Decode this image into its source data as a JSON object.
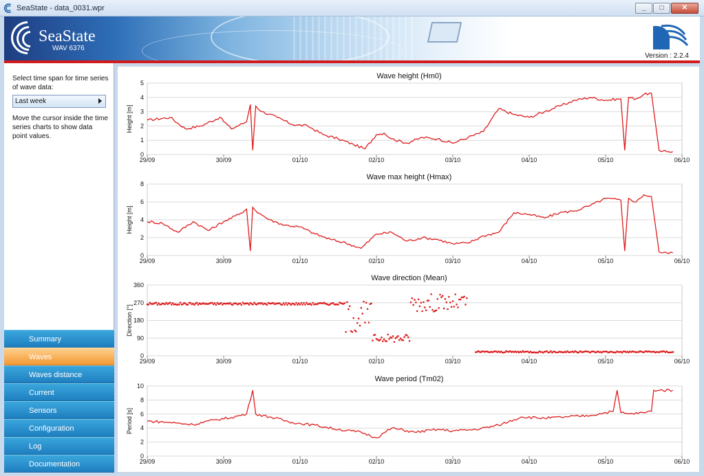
{
  "window": {
    "title": "SeaState - data_0031.wpr",
    "min": "_",
    "max": "□",
    "close": "✕"
  },
  "banner": {
    "logo_text": "SeaState",
    "logo_sub": "WAV 6376",
    "version": "Version : 2.2.4"
  },
  "left": {
    "instruction": "Select time span for time series of wave data:",
    "timespan": "Last week",
    "hint": "Move the cursor inside the time series charts to show data point values."
  },
  "nav": [
    "Summary",
    "Waves",
    "Waves distance",
    "Current",
    "Sensors",
    "Configuration",
    "Log",
    "Documentation"
  ],
  "nav_active": "Waves",
  "colors": {
    "series": "#dd1c1c",
    "accent": "#d21b1b",
    "nav": "#2a8fcd",
    "nav_active": "#f7a84a"
  },
  "chart_data": [
    {
      "type": "line",
      "title": "Wave height (Hm0)",
      "ylabel": "Height [m]",
      "ylim": [
        0,
        5
      ],
      "yticks": [
        0,
        1,
        2,
        3,
        4,
        5
      ],
      "xticks": [
        "29/09",
        "30/09",
        "01/10",
        "02/10",
        "03/10",
        "04/10",
        "05/10",
        "06/10"
      ],
      "x_days": [
        0,
        0.3,
        0.5,
        0.7,
        0.95,
        1.1,
        1.3,
        1.35,
        1.38,
        1.42,
        1.5,
        1.7,
        1.9,
        2.1,
        2.3,
        2.5,
        2.7,
        2.85,
        3.0,
        3.1,
        3.2,
        3.4,
        3.6,
        3.8,
        4.0,
        4.2,
        4.4,
        4.6,
        4.8,
        5.0,
        5.2,
        5.4,
        5.6,
        5.8,
        6.0,
        6.2,
        6.25,
        6.3,
        6.4,
        6.5,
        6.6,
        6.7,
        6.73,
        6.8,
        6.88
      ],
      "values": [
        2.4,
        2.6,
        1.8,
        2.0,
        2.6,
        1.8,
        2.3,
        3.5,
        0.3,
        3.4,
        3.0,
        2.6,
        2.1,
        2.0,
        1.4,
        1.1,
        0.7,
        0.4,
        1.4,
        1.5,
        1.1,
        0.8,
        1.2,
        1.1,
        0.8,
        1.2,
        1.6,
        3.2,
        2.8,
        2.6,
        3.0,
        3.4,
        3.8,
        4.0,
        3.8,
        3.9,
        0.3,
        4.0,
        3.9,
        4.2,
        4.3,
        0.3,
        0.2,
        0.2,
        0.2
      ]
    },
    {
      "type": "line",
      "title": "Wave max height (Hmax)",
      "ylabel": "Height [m]",
      "ylim": [
        0,
        8
      ],
      "yticks": [
        0,
        2,
        4,
        6,
        8
      ],
      "xticks": [
        "29/09",
        "30/09",
        "01/10",
        "02/10",
        "03/10",
        "04/10",
        "05/10",
        "06/10"
      ],
      "x_days": [
        0,
        0.2,
        0.4,
        0.6,
        0.8,
        1.0,
        1.2,
        1.3,
        1.35,
        1.38,
        1.42,
        1.6,
        1.8,
        2.0,
        2.2,
        2.4,
        2.6,
        2.8,
        3.0,
        3.2,
        3.4,
        3.6,
        3.8,
        4.0,
        4.2,
        4.4,
        4.6,
        4.8,
        5.0,
        5.2,
        5.4,
        5.6,
        5.8,
        6.0,
        6.2,
        6.25,
        6.3,
        6.4,
        6.5,
        6.6,
        6.7,
        6.73,
        6.8,
        6.88
      ],
      "values": [
        3.8,
        3.6,
        2.6,
        3.8,
        2.8,
        3.8,
        4.6,
        5.2,
        0.5,
        5.4,
        5.0,
        4.0,
        3.4,
        3.2,
        2.4,
        1.8,
        1.4,
        0.8,
        2.4,
        2.6,
        1.6,
        2.0,
        1.8,
        1.3,
        1.4,
        2.2,
        2.6,
        4.8,
        4.6,
        4.2,
        4.8,
        5.0,
        5.6,
        6.4,
        6.2,
        0.5,
        6.4,
        6.0,
        6.8,
        6.6,
        0.4,
        0.3,
        0.3,
        0.3
      ]
    },
    {
      "type": "scatter",
      "title": "Wave direction (Mean)",
      "ylabel": "Direction [°]",
      "ylim": [
        0,
        360
      ],
      "yticks": [
        0,
        90,
        180,
        270,
        360
      ],
      "xticks": [
        "29/09",
        "30/09",
        "01/10",
        "02/10",
        "03/10",
        "04/10",
        "05/10",
        "06/10"
      ],
      "segments": [
        {
          "from": 0,
          "to": 2.6,
          "center": 265,
          "spread": 12
        },
        {
          "from": 2.6,
          "to": 2.95,
          "center": 200,
          "spread": 160
        },
        {
          "from": 2.95,
          "to": 3.45,
          "center": 90,
          "spread": 40
        },
        {
          "from": 3.45,
          "to": 4.2,
          "center": 270,
          "spread": 90
        },
        {
          "from": 4.3,
          "to": 6.9,
          "center": 20,
          "spread": 8
        }
      ]
    },
    {
      "type": "line",
      "title": "Wave period (Tm02)",
      "ylabel": "Period [s]",
      "ylim": [
        0,
        10
      ],
      "yticks": [
        0,
        2,
        4,
        6,
        8,
        10
      ],
      "xticks": [
        "29/09",
        "30/09",
        "01/10",
        "02/10",
        "03/10",
        "04/10",
        "05/10",
        "06/10"
      ],
      "x_days": [
        0,
        0.3,
        0.6,
        0.9,
        1.1,
        1.3,
        1.38,
        1.42,
        1.6,
        1.9,
        2.2,
        2.5,
        2.8,
        3.0,
        3.2,
        3.5,
        3.8,
        4.0,
        4.3,
        4.6,
        4.9,
        5.2,
        5.5,
        5.8,
        6.0,
        6.1,
        6.15,
        6.2,
        6.3,
        6.5,
        6.6,
        6.63,
        6.88
      ],
      "values": [
        5.0,
        4.8,
        4.5,
        5.2,
        5.5,
        6.0,
        9.4,
        6.0,
        5.6,
        4.8,
        4.4,
        3.8,
        3.4,
        2.6,
        4.0,
        3.4,
        3.8,
        3.6,
        3.8,
        4.4,
        5.6,
        5.4,
        5.6,
        5.8,
        6.2,
        6.4,
        9.4,
        6.2,
        6.0,
        6.2,
        6.4,
        9.4,
        9.4
      ]
    }
  ]
}
